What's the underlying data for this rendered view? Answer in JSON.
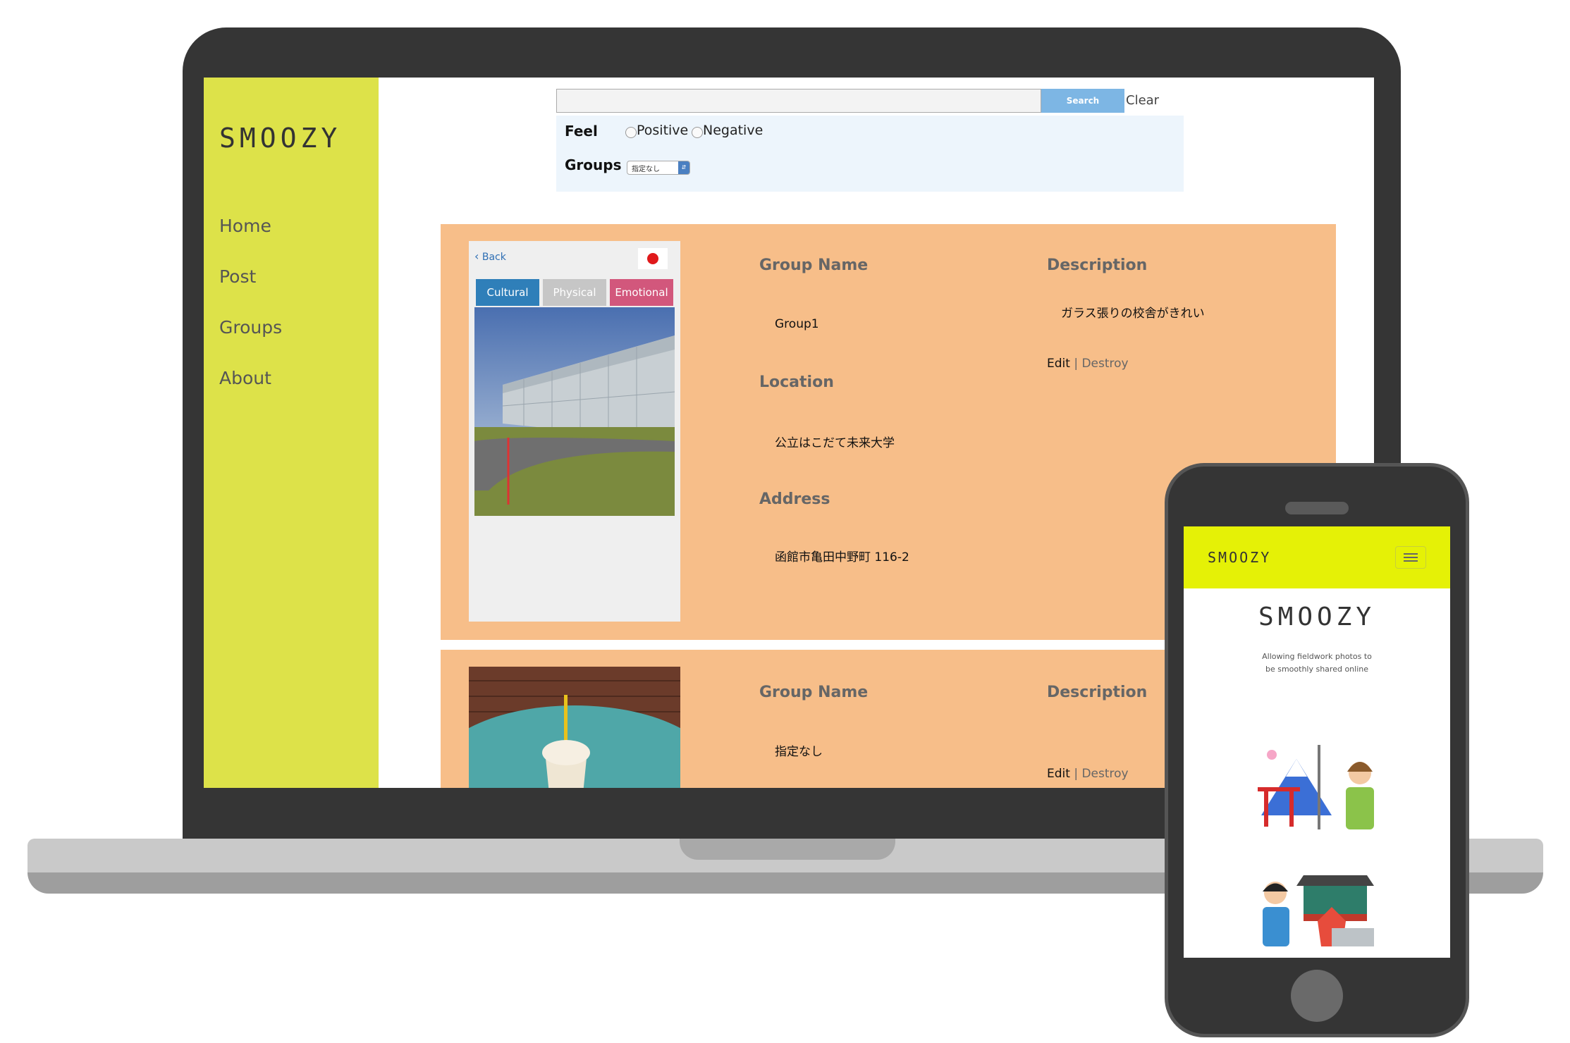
{
  "app": {
    "logo": "SMOOZY"
  },
  "sidebar": {
    "items": [
      {
        "label": "Home"
      },
      {
        "label": "Post"
      },
      {
        "label": "Groups"
      },
      {
        "label": "About"
      }
    ]
  },
  "search": {
    "value": "",
    "button_label": "Search",
    "clear_label": "Clear"
  },
  "filters": {
    "feel_label": "Feel",
    "feel_options": [
      "Positive",
      "Negative"
    ],
    "groups_label": "Groups",
    "groups_selected": "指定なし"
  },
  "cards": [
    {
      "back_label": "Back",
      "tags": [
        "Cultural",
        "Physical",
        "Emotional"
      ],
      "group_name_label": "Group Name",
      "group_name": "Group1",
      "location_label": "Location",
      "location": "公立はこだて未来大学",
      "address_label": "Address",
      "address": "函館市亀田中野町 116-2",
      "description_label": "Description",
      "description": "ガラス張りの校舎がきれい",
      "edit_label": "Edit",
      "separator": "|",
      "destroy_label": "Destroy"
    },
    {
      "group_name_label": "Group Name",
      "group_name": "指定なし",
      "description_label": "Description",
      "edit_label": "Edit",
      "separator": "|",
      "destroy_label": "Destroy"
    }
  ],
  "mobile": {
    "header_logo": "SMOOZY",
    "hero_logo": "SMOOZY",
    "tagline_line1": "Allowing fieldwork photos to",
    "tagline_line2": "be smoothly shared online"
  },
  "colors": {
    "sidebar": "#dde249",
    "card": "#f7be89",
    "search_button": "#7db6e4",
    "tag_cultural": "#2f7fb9",
    "tag_physical": "#c6c6c6",
    "tag_emotional": "#d2577c",
    "mobile_header": "#e5f106"
  }
}
